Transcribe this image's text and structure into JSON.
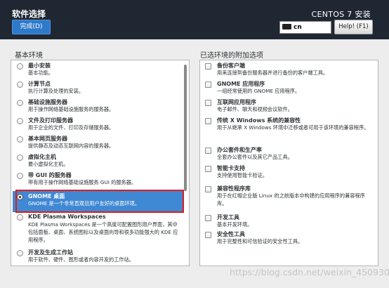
{
  "header": {
    "title": "软件选择",
    "done_label": "完成(D)",
    "product": "CENTOS 7 安装",
    "keyboard": "cn",
    "help_label": "Help! (F1)"
  },
  "left": {
    "title": "基本环境",
    "items": [
      {
        "title": "最小安装",
        "desc": "基本功能。",
        "checked": false
      },
      {
        "title": "计算节点",
        "desc": "执行计算及处理的安装。",
        "checked": false
      },
      {
        "title": "基础设施服务器",
        "desc": "用于操作网络基础设施服务的服务器。",
        "checked": false
      },
      {
        "title": "文件及打印服务器",
        "desc": "用于企业的文件、打印及存储服务器。",
        "checked": false
      },
      {
        "title": "基本网页服务器",
        "desc": "提供静态及动态互联网内容的服务器。",
        "checked": false
      },
      {
        "title": "虚拟化主机",
        "desc": "最小虚拟化主机。",
        "checked": false
      },
      {
        "title": "带 GUI 的服务器",
        "desc": "带有用于操作网络基础设施服务 GUI 的服务器。",
        "checked": false
      },
      {
        "title": "GNOME 桌面",
        "desc": "GNOME 是一个非常直观且用户友好的桌面环境。",
        "checked": true
      },
      {
        "title": "KDE Plasma Workspaces",
        "desc": "KDE Plasma Workspaces 是一个高度可配置图形用户界面，其中包括面板、桌面、系统图标以及桌面向导和很多功能强大的 KDE 应用程序。",
        "checked": false
      },
      {
        "title": "开发及生成工作站",
        "desc": "用于软件、硬件、图形或者内容开发的工作站。",
        "checked": false
      }
    ]
  },
  "right": {
    "title": "已选环境的附加选项",
    "items": [
      {
        "title": "备份客户端",
        "desc": "用来连接到备份服务器并进行备份的客户端工具。"
      },
      {
        "title": "GNOME 应用程序",
        "desc": "一组经常使用的 GNOME 应用程序。"
      },
      {
        "title": "互联网应用程序",
        "desc": "电子邮件、聊天和视频会议软件。"
      },
      {
        "title": "传统 X Windows 系统的兼容性",
        "desc": "用于从继承 X Windows 环境中迁移或者可用于该环境的兼容程序。"
      },
      {
        "title": "办公套件和生产率",
        "desc": "全套办公套件以及其它产品工具。"
      },
      {
        "title": "智能卡支持",
        "desc": "支持使用智能卡验证。"
      },
      {
        "title": "兼容性程序库",
        "desc": "用于在红帽企业版 Linux 的之前版本中构建的应用程序的兼容程序库。"
      },
      {
        "title": "开发工具",
        "desc": "基本开发环境。"
      },
      {
        "title": "安全性工具",
        "desc": "用于完整性和可信验证的安全性工具。"
      }
    ]
  },
  "watermark": "https://blog.csdn.net/weixin_45093060"
}
